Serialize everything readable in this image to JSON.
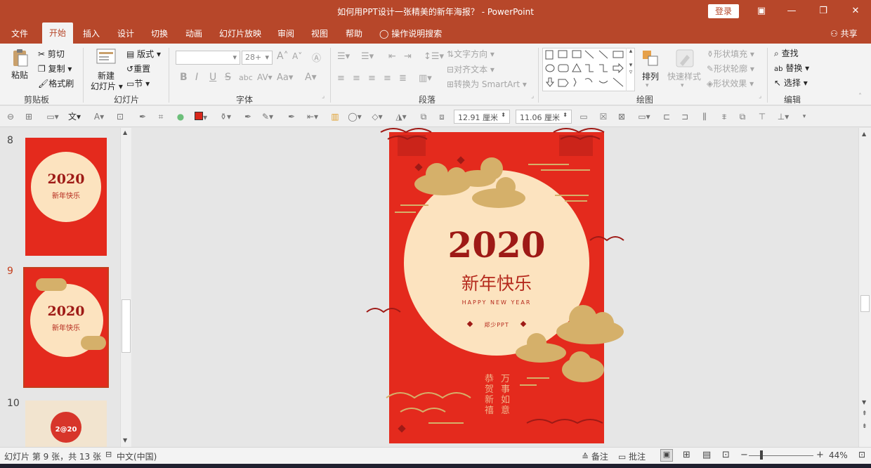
{
  "window": {
    "title": "如何用PPT设计一张精美的新年海报？ - PowerPoint",
    "login": "登录"
  },
  "tabs": {
    "items": [
      "文件",
      "开始",
      "插入",
      "设计",
      "切换",
      "动画",
      "幻灯片放映",
      "审阅",
      "视图",
      "帮助"
    ],
    "active": "开始",
    "tell_me": "操作说明搜索",
    "share": "共享"
  },
  "ribbon": {
    "clipboard": {
      "paste": "粘贴",
      "cut": "剪切",
      "copy": "复制",
      "format_painter": "格式刷",
      "label": "剪贴板"
    },
    "slides": {
      "new_slide_1": "新建",
      "new_slide_2": "幻灯片",
      "layout": "版式",
      "reset": "重置",
      "section": "节",
      "label": "幻灯片"
    },
    "font": {
      "font_size": "28+",
      "bold": "B",
      "italic": "I",
      "underline": "U",
      "strike": "S",
      "shadow": "abc",
      "spacing": "AV",
      "case": "Aa",
      "color": "A",
      "label": "字体"
    },
    "paragraph": {
      "text_direction": "文字方向",
      "align_text": "对齐文本",
      "smartart": "转换为 SmartArt",
      "label": "段落"
    },
    "drawing": {
      "arrange": "排列",
      "quick_styles": "快速样式",
      "shape_fill": "形状填充",
      "shape_outline": "形状轮廓",
      "shape_effects": "形状效果",
      "label": "绘图"
    },
    "editing": {
      "find": "查找",
      "replace": "替换",
      "select": "选择",
      "label": "编辑"
    }
  },
  "qat": {
    "width": "12.91 厘米",
    "height": "11.06 厘米"
  },
  "thumbnails": [
    {
      "number": "8",
      "year": "2020",
      "greeting": "新年快乐"
    },
    {
      "number": "9",
      "year": "2020",
      "greeting": "新年快乐"
    },
    {
      "number": "10",
      "year": "2@20"
    }
  ],
  "slide": {
    "year": "2020",
    "greeting": "新年快乐",
    "subtitle": "HAPPY NEW YEAR",
    "signature": "郑少PPT",
    "blessing_col1": "恭贺新禧",
    "blessing_col2": "万事如意"
  },
  "status": {
    "slide_info": "幻灯片 第 9 张，共 13 张",
    "language": "中文(中国)",
    "notes": "备注",
    "comments": "批注",
    "zoom": "44%"
  },
  "colors": {
    "accent": "#b7472a",
    "poster_red": "#e42a1d",
    "moon": "#fce3bf",
    "gold": "#d5b06a",
    "dark_red": "#9e1a16"
  }
}
